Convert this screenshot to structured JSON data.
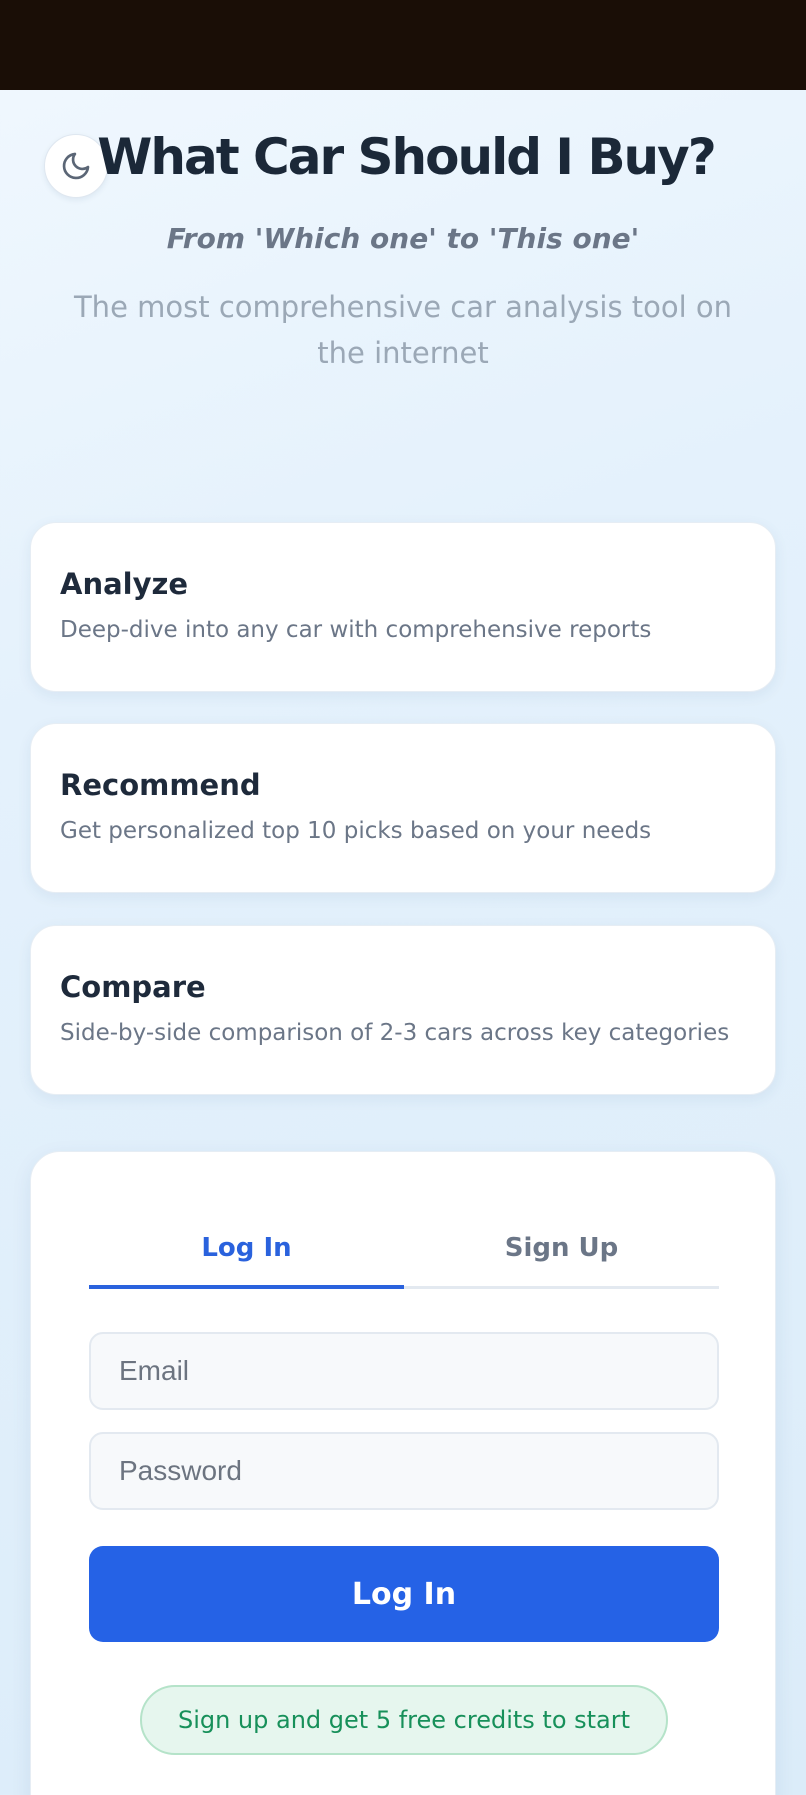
{
  "header": {
    "title": "What Car Should I Buy?",
    "tagline": "From 'Which one' to 'This one'",
    "subtitle": "The most comprehensive car analysis tool on the internet",
    "theme_toggle_icon": "moon-icon"
  },
  "features": [
    {
      "title": "Analyze",
      "description": "Deep-dive into any car with comprehensive reports"
    },
    {
      "title": "Recommend",
      "description": "Get personalized top 10 picks based on your needs"
    },
    {
      "title": "Compare",
      "description": "Side-by-side comparison of 2-3 cars across key categories"
    }
  ],
  "auth": {
    "tabs": [
      {
        "label": "Log In",
        "active": true
      },
      {
        "label": "Sign Up",
        "active": false
      }
    ],
    "email_placeholder": "Email",
    "password_placeholder": "Password",
    "submit_label": "Log In",
    "promo_text": "Sign up and get 5 free credits to start"
  },
  "colors": {
    "accent": "#2562e6",
    "promo_text": "#17905a",
    "promo_bg": "#e6f6ee",
    "status_bar": "#1a0e06"
  }
}
